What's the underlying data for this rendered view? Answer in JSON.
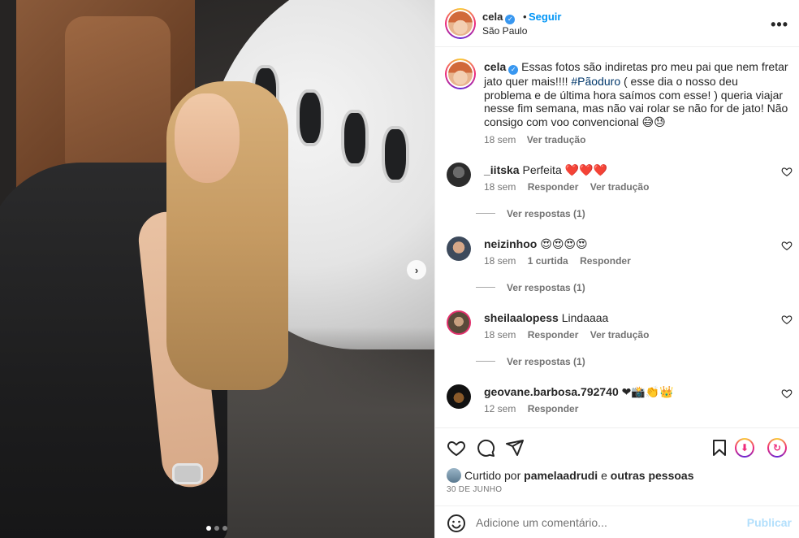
{
  "post": {
    "image_alt": "Foto de mulher ao lado de jato",
    "carousel": {
      "next_icon": "chevron-right-icon",
      "dot_count": 3,
      "active_index": 0
    }
  },
  "header": {
    "username": "cela",
    "separator": "•",
    "follow_label": "Seguir",
    "location": "São Paulo",
    "more_icon": "more-horizontal-icon"
  },
  "caption": {
    "username": "cela",
    "text_before": "Essas fotos são indiretas pro meu pai que nem fretar jato quer mais!!!! ",
    "hashtag": "#Pãoduro",
    "text_after": " ( esse dia o nosso deu problema e de última hora saímos com esse! ) queria viajar nesse fim semana, mas não vai rolar se não for de jato! Não consigo com voo convencional 😅😓",
    "time": "18 sem",
    "translate_label": "Ver tradução"
  },
  "comments": [
    {
      "username": "_iitska",
      "text": "Perfeita ❤️❤️❤️",
      "time": "18 sem",
      "actions": [
        "Responder",
        "Ver tradução"
      ],
      "replies_label": "Ver respostas (1)"
    },
    {
      "username": "neizinhoo",
      "text": "😍😍😍😍",
      "time": "18 sem",
      "actions": [
        "1 curtida",
        "Responder"
      ],
      "replies_label": "Ver respostas (1)"
    },
    {
      "username": "sheilaalopess",
      "text": "Lindaaaa",
      "time": "18 sem",
      "actions": [
        "Responder",
        "Ver tradução"
      ],
      "replies_label": "Ver respostas (1)"
    },
    {
      "username": "geovane.barbosa.792740",
      "text": "❤📸👏👑",
      "time": "12 sem",
      "actions": [
        "Responder"
      ]
    }
  ],
  "actions": {
    "like_icon": "heart-icon",
    "comment_icon": "comment-icon",
    "share_icon": "send-icon",
    "save_icon": "bookmark-icon"
  },
  "likes": {
    "prefix": "Curtido por ",
    "user": "pamelaadrudi",
    "middle": " e ",
    "others": "outras pessoas"
  },
  "date": "30 DE JUNHO",
  "comment_box": {
    "placeholder": "Adicione um comentário...",
    "publish_label": "Publicar",
    "emoji_icon": "emoji-icon"
  },
  "colors": {
    "accent": "#0095f6",
    "link_dark": "#00376b",
    "muted": "#737373",
    "publish_disabled": "#b2dffc"
  }
}
